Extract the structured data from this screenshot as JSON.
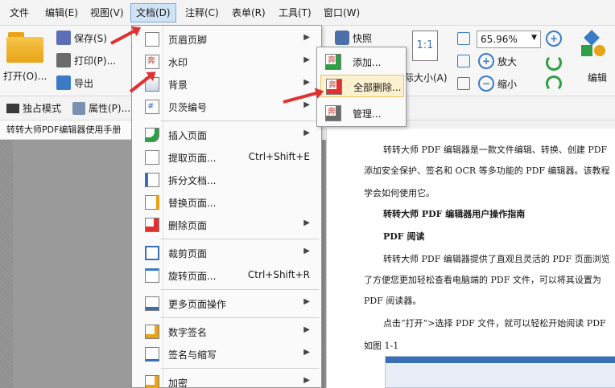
{
  "menubar": {
    "items": [
      "文件",
      "编辑(E)",
      "视图(V)",
      "文档(D)",
      "注释(C)",
      "表单(R)",
      "工具(T)",
      "窗口(W)"
    ]
  },
  "ribbon": {
    "open_label": "打开(O)...",
    "save_label": "保存(S)",
    "print_label": "打印(P)...",
    "export_label": "导出",
    "snapshot_label": "快照",
    "actual_size_label": "实际大小(A)",
    "actual_size_display": "际大小(A)",
    "actual_size_icon_text": "1:1",
    "zoom_value": "65.96%",
    "zoom_in_label": "放大",
    "zoom_out_label": "缩小",
    "edit_label": "编辑"
  },
  "toolbar2": {
    "exclusive_label": "独占模式",
    "properties_label": "属性(P)..."
  },
  "doctab": {
    "title": "转转大师PDF编辑器使用手册"
  },
  "dropdown": {
    "items": [
      {
        "label": "页眉页脚",
        "shortcut": "",
        "submenu": true
      },
      {
        "label": "水印",
        "shortcut": "",
        "submenu": true
      },
      {
        "label": "背景",
        "shortcut": "",
        "submenu": true
      },
      {
        "label": "贝茨编号",
        "shortcut": "",
        "submenu": true
      },
      {
        "label": "插入页面",
        "shortcut": "",
        "submenu": true
      },
      {
        "label": "提取页面...",
        "shortcut": "Ctrl+Shift+E",
        "submenu": false
      },
      {
        "label": "拆分文档...",
        "shortcut": "",
        "submenu": false
      },
      {
        "label": "替换页面...",
        "shortcut": "",
        "submenu": false
      },
      {
        "label": "删除页面",
        "shortcut": "",
        "submenu": true
      },
      {
        "label": "裁剪页面",
        "shortcut": "",
        "submenu": true
      },
      {
        "label": "旋转页面...",
        "shortcut": "Ctrl+Shift+R",
        "submenu": false
      },
      {
        "label": "更多页面操作",
        "shortcut": "",
        "submenu": true
      },
      {
        "label": "数字签名",
        "shortcut": "",
        "submenu": true
      },
      {
        "label": "签名与缩写",
        "shortcut": "",
        "submenu": true
      },
      {
        "label": "加密",
        "shortcut": "",
        "submenu": true
      }
    ],
    "arrow_glyph": "▶"
  },
  "submenu": {
    "items": [
      {
        "label": "添加..."
      },
      {
        "label": "全部删除..."
      },
      {
        "label": "管理..."
      }
    ]
  },
  "document": {
    "lines": [
      "转转大师 PDF 编辑器是一款文件编辑、转换、创建 PDF",
      "添加安全保护、签名和 OCR 等多功能的 PDF 编辑器。该教程",
      "学会如何使用它。",
      "转转大师 PDF 编辑器用户操作指南",
      "PDF 阅读",
      "转转大师 PDF 编辑器提供了直观且灵活的 PDF 页面浏览",
      "了方便您更加轻松查看电脑端的 PDF 文件，可以将其设置为",
      "PDF 阅读器。",
      "点击“打开”>选择 PDF 文件，就可以轻松开始阅读 PDF",
      "如图 1-1"
    ]
  },
  "colors": {
    "accent": "#e03030",
    "menu_active": "#cfe3f5",
    "highlight": "#fdf1cf"
  },
  "icons": {
    "watermark_doc_char": "奔",
    "page_char": "#"
  }
}
